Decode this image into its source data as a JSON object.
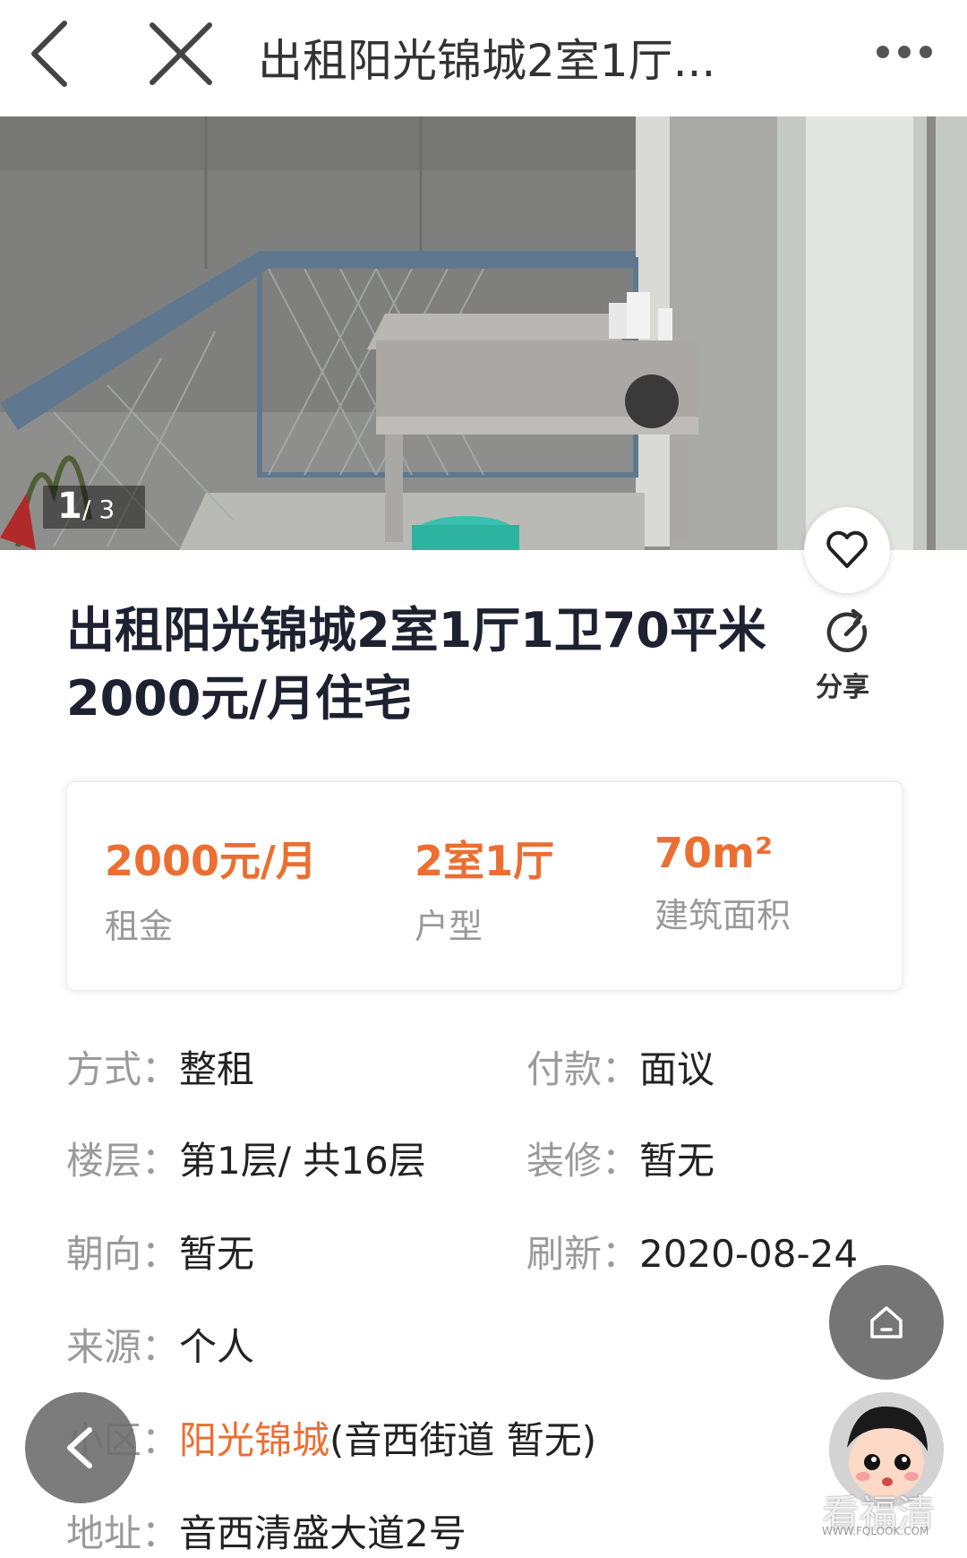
{
  "topbar": {
    "title": "出租阳光锦城2室1厅..."
  },
  "gallery": {
    "current": "1",
    "total_text": "/ 3"
  },
  "listing": {
    "title": "出租阳光锦城2室1厅1卫70平米2000元/月住宅",
    "share_label": "分享"
  },
  "stats": [
    {
      "value": "2000元/月",
      "label": "租金"
    },
    {
      "value": "2室1厅",
      "label": "户型"
    },
    {
      "value": "70m²",
      "label": "建筑面积"
    }
  ],
  "details": {
    "method_key": "方式：",
    "method_val": "整租",
    "payment_key": "付款：",
    "payment_val": "面议",
    "floor_key": "楼层：",
    "floor_val": "第1层/ 共16层",
    "decor_key": "装修：",
    "decor_val": "暂无",
    "orient_key": "朝向：",
    "orient_val": "暂无",
    "refresh_key": "刷新：",
    "refresh_val": "2020-08-24",
    "source_key": "来源：",
    "source_val": "个人",
    "community_key": "小区：",
    "community_link": "阳光锦城",
    "community_extra": "(音西街道 暂无)",
    "address_key": "地址：",
    "address_val": "音西清盛大道2号"
  },
  "watermark": {
    "text": "看福清",
    "sub": "WWW.FQLOOK.COM"
  },
  "colors": {
    "accent": "#ec6e31",
    "title": "#1d2130",
    "label_gray": "#9a9a9a"
  },
  "icons": [
    "back-arrow-icon",
    "close-icon",
    "more-icon",
    "heart-icon",
    "share-icon",
    "home-icon",
    "chevron-left-icon"
  ]
}
